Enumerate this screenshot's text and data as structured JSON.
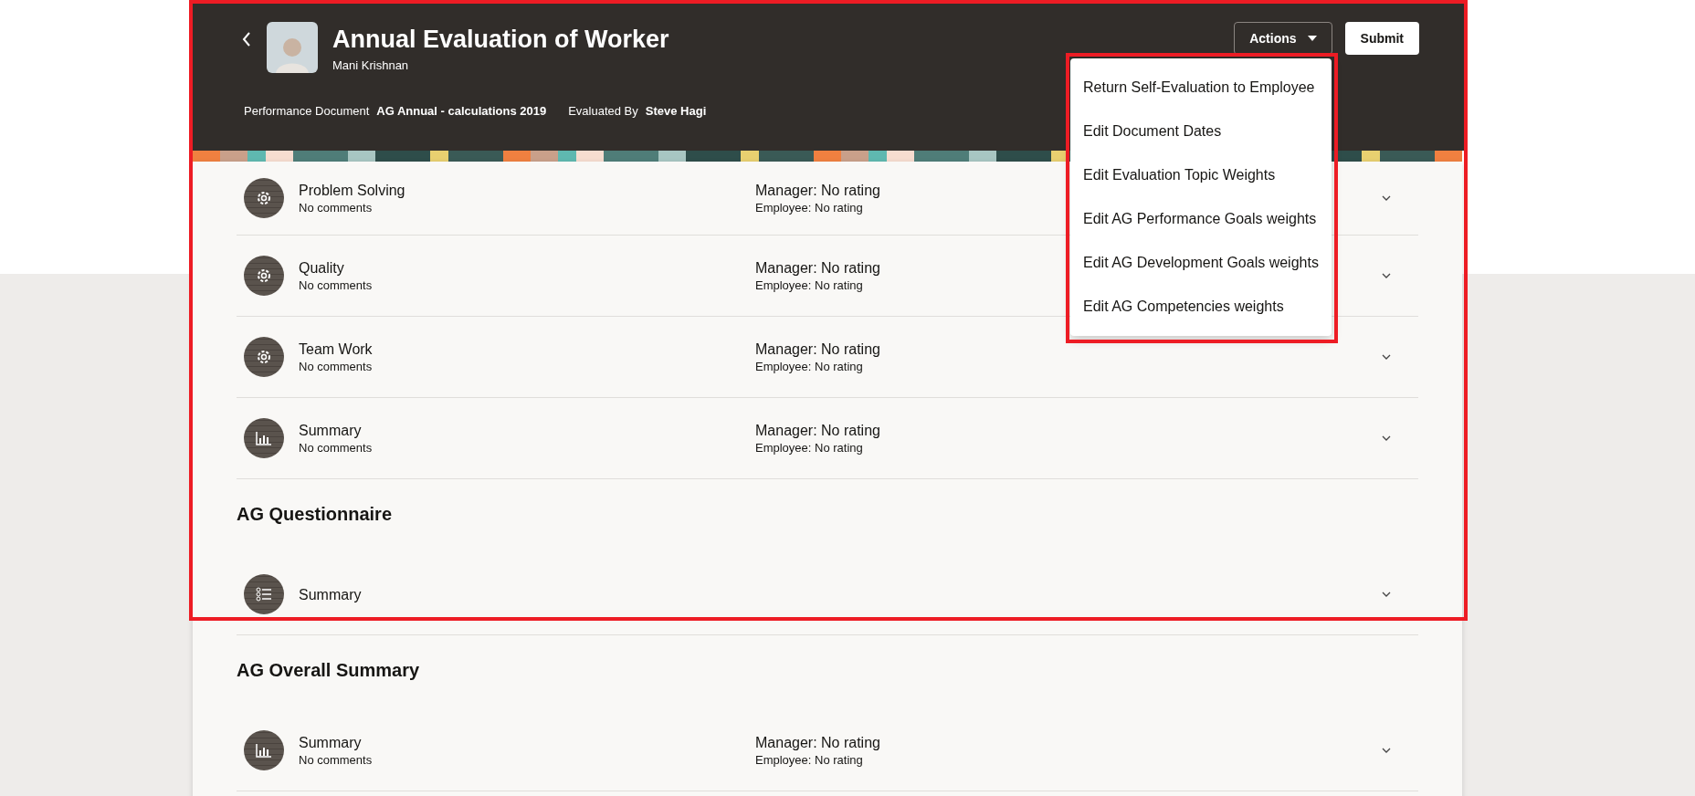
{
  "header": {
    "title": "Annual Evaluation of Worker",
    "worker_name": "Mani Krishnan",
    "document_label": "Performance Document",
    "document_value": "AG Annual - calculations 2019",
    "evaluator_label": "Evaluated By",
    "evaluator_value": "Steve Hagi"
  },
  "actions_button": {
    "label": "Actions",
    "expanded": true
  },
  "submit_button": {
    "label": "Submit"
  },
  "actions_menu": [
    "Return Self-Evaluation to Employee",
    "Edit Document Dates",
    "Edit Evaluation Topic Weights",
    "Edit AG Performance Goals weights",
    "Edit AG Development Goals weights",
    "Edit AG Competencies weights"
  ],
  "sections": [
    {
      "items": [
        {
          "kind": "gear",
          "name": "Problem Solving",
          "comment": "No comments",
          "manager_rating": "Manager: No rating",
          "employee_rating": "Employee: No rating"
        },
        {
          "kind": "gear",
          "name": "Quality",
          "comment": "No comments",
          "manager_rating": "Manager: No rating",
          "employee_rating": "Employee: No rating"
        },
        {
          "kind": "gear",
          "name": "Team Work",
          "comment": "No comments",
          "manager_rating": "Manager: No rating",
          "employee_rating": "Employee: No rating"
        },
        {
          "kind": "chart",
          "name": "Summary",
          "comment": "No comments",
          "manager_rating": "Manager: No rating",
          "employee_rating": "Employee: No rating"
        }
      ]
    },
    {
      "title": "AG Questionnaire",
      "items": [
        {
          "kind": "list",
          "name": "Summary"
        }
      ]
    },
    {
      "title": "AG Overall Summary",
      "items": [
        {
          "kind": "chart",
          "name": "Summary",
          "comment": "No comments",
          "manager_rating": "Manager: No rating",
          "employee_rating": "Employee: No rating"
        }
      ]
    }
  ]
}
